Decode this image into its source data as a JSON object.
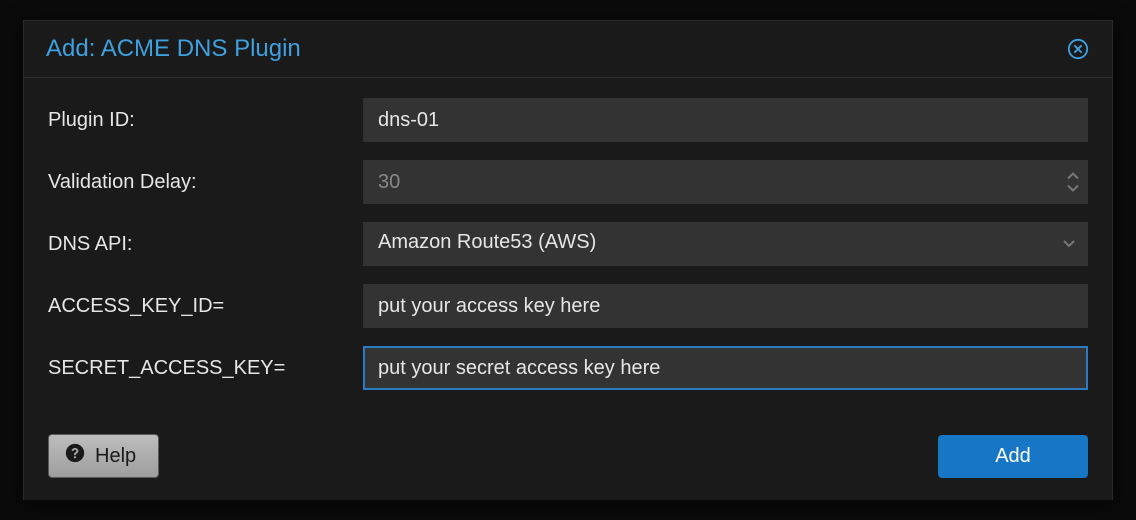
{
  "dialog": {
    "title": "Add: ACME DNS Plugin"
  },
  "form": {
    "plugin_id": {
      "label": "Plugin ID:",
      "value": "dns-01"
    },
    "validation_delay": {
      "label": "Validation Delay:",
      "value": "30"
    },
    "dns_api": {
      "label": "DNS API:",
      "selected": "Amazon Route53 (AWS)"
    },
    "access_key_id": {
      "label": "ACCESS_KEY_ID=",
      "value": "put your access key here"
    },
    "secret_access_key": {
      "label": "SECRET_ACCESS_KEY=",
      "value": "put your secret access key here"
    }
  },
  "footer": {
    "help_label": "Help",
    "add_label": "Add"
  },
  "colors": {
    "accent": "#3fa0e0",
    "primary_button": "#1776c5",
    "input_bg": "#333333",
    "dialog_bg": "#1a1a1a"
  }
}
